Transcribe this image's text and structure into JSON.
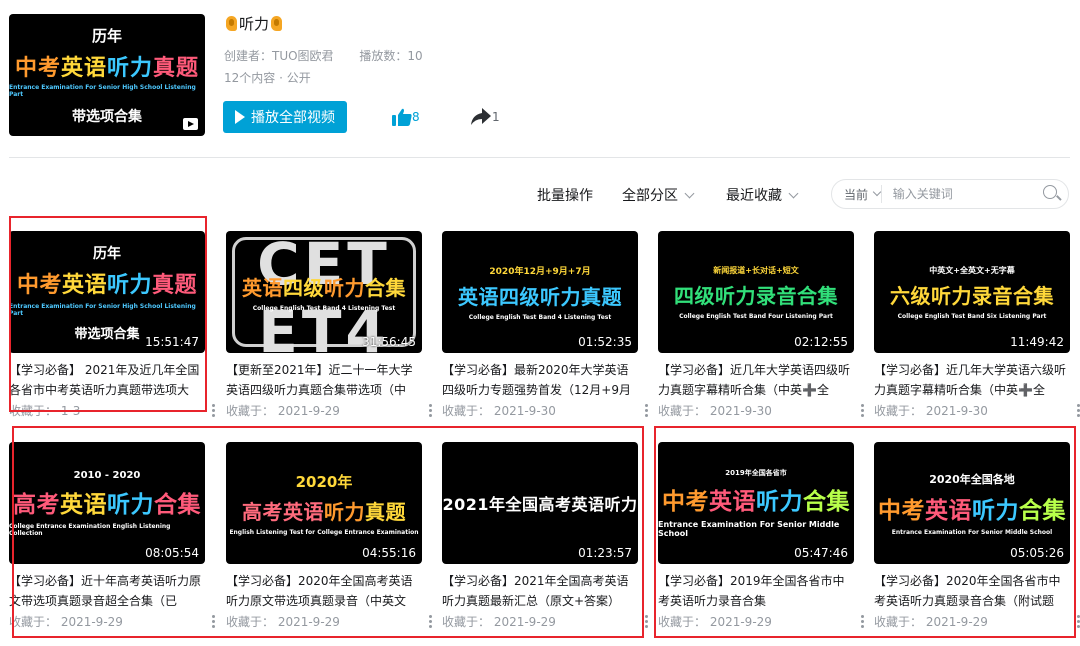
{
  "playlist": {
    "cover": {
      "top": "历年",
      "main_parts": [
        "中考",
        "英语",
        "听力",
        "真题"
      ],
      "sub": "Entrance Examination For Senior High School Listening Part",
      "bottom": "带选项合集"
    },
    "title": "听力",
    "creator": "创建者：TUO图欧君",
    "plays": "播放数：10",
    "count_visibility": "12个内容 · 公开",
    "play_all": "播放全部视频",
    "likes": "8",
    "shares": "1"
  },
  "toolbar": {
    "batch": "批量操作",
    "partition": "全部分区",
    "sort": "最近收藏",
    "scope": "当前",
    "search_placeholder": "输入关键词"
  },
  "videos": [
    {
      "thumb_top": "历年",
      "thumb_main": [
        "中考",
        "英语",
        "听力",
        "真题"
      ],
      "thumb_sub": "Entrance Examination For Senior High School Listening Part",
      "thumb_bot": "带选项合集",
      "duration": "15:51:47",
      "title": "【学习必备】 2021年及近几年全国各省市中考英语听力真题带选项大",
      "foot": "收藏于： 1-3"
    },
    {
      "thumb_main": [
        "英语",
        "四级",
        "听力",
        "合集"
      ],
      "thumb_sub": "College English Test Band 4 Listening Test",
      "bg": [
        "CET",
        "ET4"
      ],
      "duration": "31:56:45",
      "title": "【更新至2021年】近二十一年大学英语四级听力真题合集带选项（中",
      "foot": "收藏于： 2021-9-29"
    },
    {
      "thumb_top": "2020年12月+9月+7月",
      "thumb_main": [
        "英语",
        "四级",
        "听力",
        "真题"
      ],
      "thumb_sub": "College English Test Band 4 Listening Test",
      "duration": "01:52:35",
      "title": "【学习必备】最新2020年大学英语四级听力专题强势首发（12月+9月",
      "foot": "收藏于： 2021-9-30"
    },
    {
      "thumb_top": "新闻报道+长对话+短文",
      "thumb_main": [
        "四级",
        "听力",
        "录音",
        "合集"
      ],
      "thumb_sub": "College English Test Band Four Listening Part",
      "duration": "02:12:55",
      "title": "【学习必备】近几年大学英语四级听力真题字幕精听合集（中英➕全",
      "foot": "收藏于： 2021-9-30"
    },
    {
      "thumb_top": "中英文+全英文+无字幕",
      "thumb_main": [
        "六级",
        "听力",
        "录音",
        "合集"
      ],
      "thumb_sub": "College English Test Band Six Listening Part",
      "duration": "11:49:42",
      "title": "【学习必备】近几年大学英语六级听力真题字幕精听合集（中英➕全",
      "foot": "收藏于： 2021-9-30"
    },
    {
      "thumb_top": "2010 - 2020",
      "thumb_main": [
        "高考",
        "英语",
        "听力",
        "合集"
      ],
      "thumb_sub": "College Entrance Examination English Listening Collection",
      "duration": "08:05:54",
      "title": "【学习必备】近十年高考英语听力原文带选项真题录音超全合集（已",
      "foot": "收藏于： 2021-9-29"
    },
    {
      "thumb_top": "2020年",
      "thumb_main": [
        "高考",
        "英语",
        "听力",
        "真题"
      ],
      "thumb_sub": "English Listening Test for College Entrance Examination",
      "duration": "04:55:16",
      "title": "【学习必备】2020年全国高考英语听力原文带选项真题录音（中英文",
      "foot": "收藏于： 2021-9-29"
    },
    {
      "thumb_main": [
        "2021年全国高考英语听力"
      ],
      "duration": "01:23:57",
      "title": "【学习必备】2021年全国高考英语听力真题最新汇总（原文+答案）",
      "foot": "收藏于： 2021-9-29"
    },
    {
      "thumb_top": "2019年全国各省市",
      "thumb_main": [
        "中考",
        "英语",
        "听力",
        "合集"
      ],
      "thumb_sub": "Entrance Examination For Senior Middle School",
      "duration": "05:47:46",
      "title": "【学习必备】2019年全国各省市中考英语听力录音合集",
      "foot": "收藏于： 2021-9-29"
    },
    {
      "thumb_top": "2020年全国各地",
      "thumb_main": [
        "中考",
        "英语",
        "听力",
        "合集"
      ],
      "thumb_sub": "Entrance Examination For Senior Middle School",
      "duration": "05:05:26",
      "title": "【学习必备】2020年全国各省市中考英语听力真题录音合集（附试题",
      "foot": "收藏于： 2021-9-29"
    }
  ],
  "colors": {
    "accent": "#00a1d6",
    "highlight_box": "#e8242c"
  }
}
